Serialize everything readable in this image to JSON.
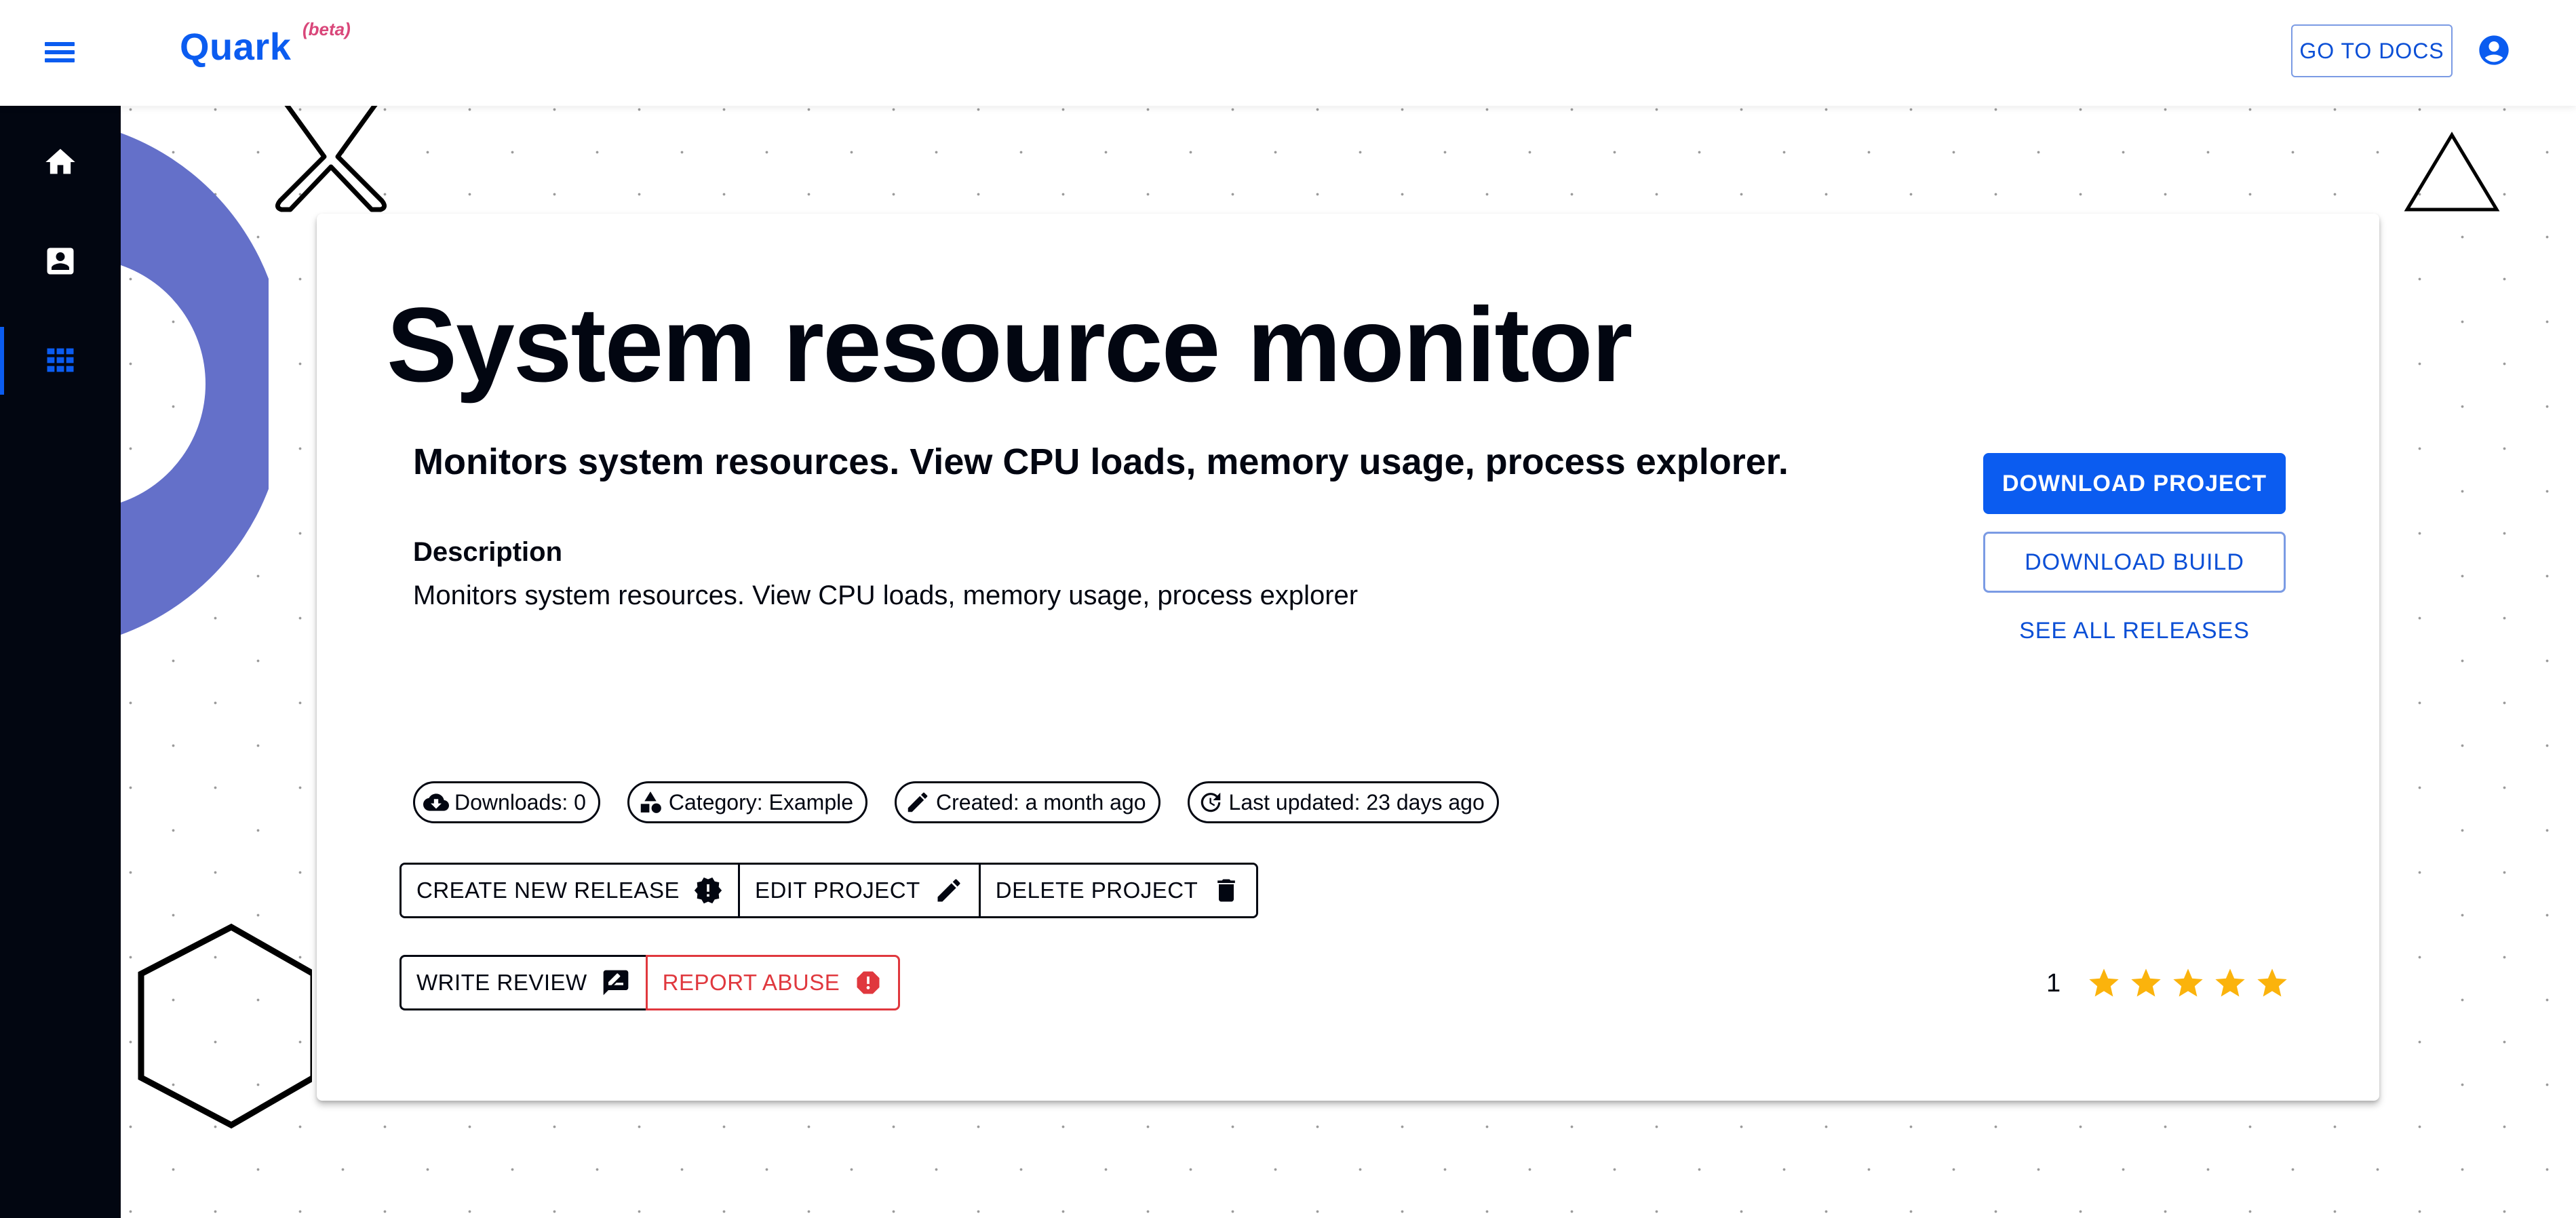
{
  "header": {
    "brand": "Quark",
    "badge": "(beta)",
    "docs_button": "GO TO DOCS",
    "icons": {
      "menu": "hamburger-menu-icon",
      "account": "account-circle-icon"
    }
  },
  "sidebar": {
    "items": [
      {
        "name": "home",
        "icon": "home-icon",
        "active": false
      },
      {
        "name": "profile",
        "icon": "contact-card-icon",
        "active": false
      },
      {
        "name": "apps",
        "icon": "apps-grid-icon",
        "active": true
      }
    ]
  },
  "project": {
    "title": "System resource monitor",
    "summary": "Monitors system resources. View CPU loads, memory usage, process explorer.",
    "description_label": "Description",
    "description": "Monitors system resources. View CPU loads, memory usage, process explorer",
    "actions": {
      "download_project": "DOWNLOAD PROJECT",
      "download_build": "DOWNLOAD BUILD",
      "see_all_releases": "SEE ALL RELEASES"
    },
    "chips": [
      {
        "icon": "cloud-download-icon",
        "label": "Downloads: 0"
      },
      {
        "icon": "category-icon",
        "label": "Category: Example"
      },
      {
        "icon": "pencil-icon",
        "label": "Created: a month ago"
      },
      {
        "icon": "update-icon",
        "label": "Last updated: 23 days ago"
      }
    ],
    "manage_buttons": [
      {
        "label": "CREATE NEW RELEASE",
        "icon": "new-release-icon"
      },
      {
        "label": "EDIT PROJECT",
        "icon": "edit-icon"
      },
      {
        "label": "DELETE PROJECT",
        "icon": "trash-icon"
      }
    ],
    "review_buttons": [
      {
        "label": "WRITE REVIEW",
        "icon": "rate-review-icon"
      },
      {
        "label": "REPORT ABUSE",
        "icon": "report-icon"
      }
    ],
    "rating": {
      "count": "1",
      "stars_filled": 5,
      "stars_total": 5
    }
  },
  "colors": {
    "accent": "#0b5cf0",
    "danger": "#e0383e",
    "star": "#fbb30c",
    "sidebar_bg": "#020611",
    "decor_circle": "#6470c9",
    "beta": "#d9477a"
  }
}
